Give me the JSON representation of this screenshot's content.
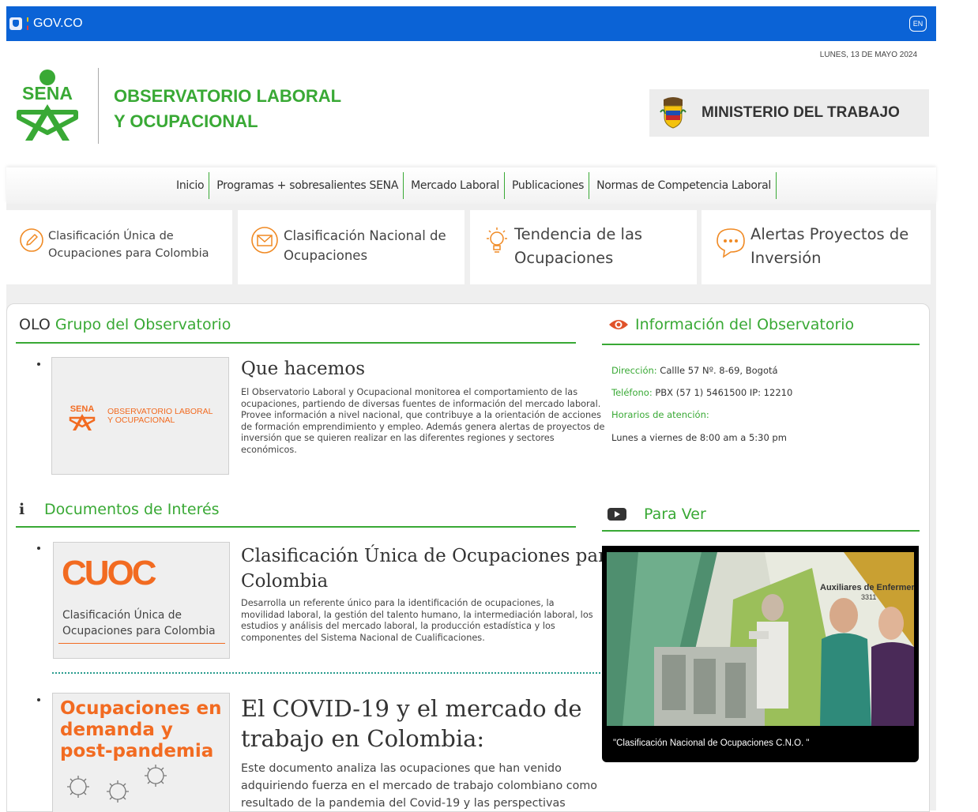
{
  "gov_bar": {
    "brand": "GOV.CO",
    "lang_button": "EN"
  },
  "date": "LUNES, 13 DE MAYO 2024",
  "header": {
    "sena_logo_text": "SENA",
    "title_line1": "OBSERVATORIO LABORAL",
    "title_line2": "Y OCUPACIONAL",
    "ministry": "MINISTERIO DEL TRABAJO"
  },
  "nav": {
    "items": [
      {
        "label": "Inicio"
      },
      {
        "label": "Programas + sobresalientes SENA"
      },
      {
        "label": "Mercado Laboral"
      },
      {
        "label": "Publicaciones"
      },
      {
        "label": "Normas de Competencia Laboral"
      }
    ]
  },
  "cards": [
    {
      "line1": "Clasificación Única de",
      "line2": "Ocupaciones para Colombia",
      "icon": "pencil-icon"
    },
    {
      "line1": "Clasificación Nacional de",
      "line2": "Ocupaciones",
      "icon": "envelope-icon"
    },
    {
      "line1": "Tendencia de las",
      "line2": "Ocupaciones",
      "icon": "lightbulb-icon"
    },
    {
      "line1": "Alertas Proyectos de",
      "line2": "Inversión",
      "icon": "chat-bubble-icon"
    }
  ],
  "group": {
    "heading_prefix": "OLO",
    "heading": "Grupo del Observatorio",
    "thumb_logo": "SENA",
    "thumb_line1": "OBSERVATORIO LABORAL",
    "thumb_line2": "Y OCUPACIONAL",
    "title": "Que hacemos",
    "body": "El Observatorio Laboral y Ocupacional monitorea el comportamiento de las ocupaciones, partiendo de diversas fuentes de información del mercado laboral. Provee información a nivel nacional, que contribuye a la orientación de acciones de formación emprendimiento y empleo. Además genera alertas de proyectos de inversión que se quieren realizar en las diferentes regiones y sectores económicos."
  },
  "info": {
    "heading": "Información del Observatorio",
    "address_label": "Dirección:",
    "address": "Callle 57 Nº. 8-69, Bogotá",
    "phone_label": "Teléfono:",
    "phone": "PBX (57 1) 5461500 IP: 12210",
    "hours_label": "Horarios de atención:",
    "hours": "Lunes a viernes de 8:00 am a 5:30 pm"
  },
  "documents": {
    "heading": "Documentos de Interés",
    "doc1": {
      "thumb_big": "CUOC",
      "thumb_line1": "Clasificación Única de",
      "thumb_line2": "Ocupaciones para Colombia",
      "title_line1": "Clasificación Única de Ocupaciones para",
      "title_line2": "Colombia",
      "body": "Desarrolla un referente único para la identificación de ocupaciones, la movilidad laboral, la gestión del talento humano, la intermediación laboral, los estudios y análisis del mercado laboral, la producción estadística y los componentes del Sistema Nacional de Cualificaciones."
    },
    "doc2": {
      "thumb_line1": "Ocupaciones en",
      "thumb_line2": "demanda y",
      "thumb_line3": "post-pandemia",
      "title_line1": "El COVID-19 y el mercado de",
      "title_line2": "trabajo en Colombia:",
      "body": "Este documento analiza las ocupaciones que han venido adquiriendo fuerza en el mercado de trabajo colombiano como resultado de la pandemia del Covid-19 y las perspectivas"
    }
  },
  "video": {
    "heading": "Para Ver",
    "overlay_title": "Auxiliares de Enfermería",
    "overlay_code": "3311",
    "caption": "\"Clasificación Nacional de Ocupaciones C.N.O. \""
  },
  "colors": {
    "gov_blue": "#0b63d6",
    "green": "#39a935",
    "orange": "#f26b21",
    "teal_dots": "#2a9d8f"
  }
}
